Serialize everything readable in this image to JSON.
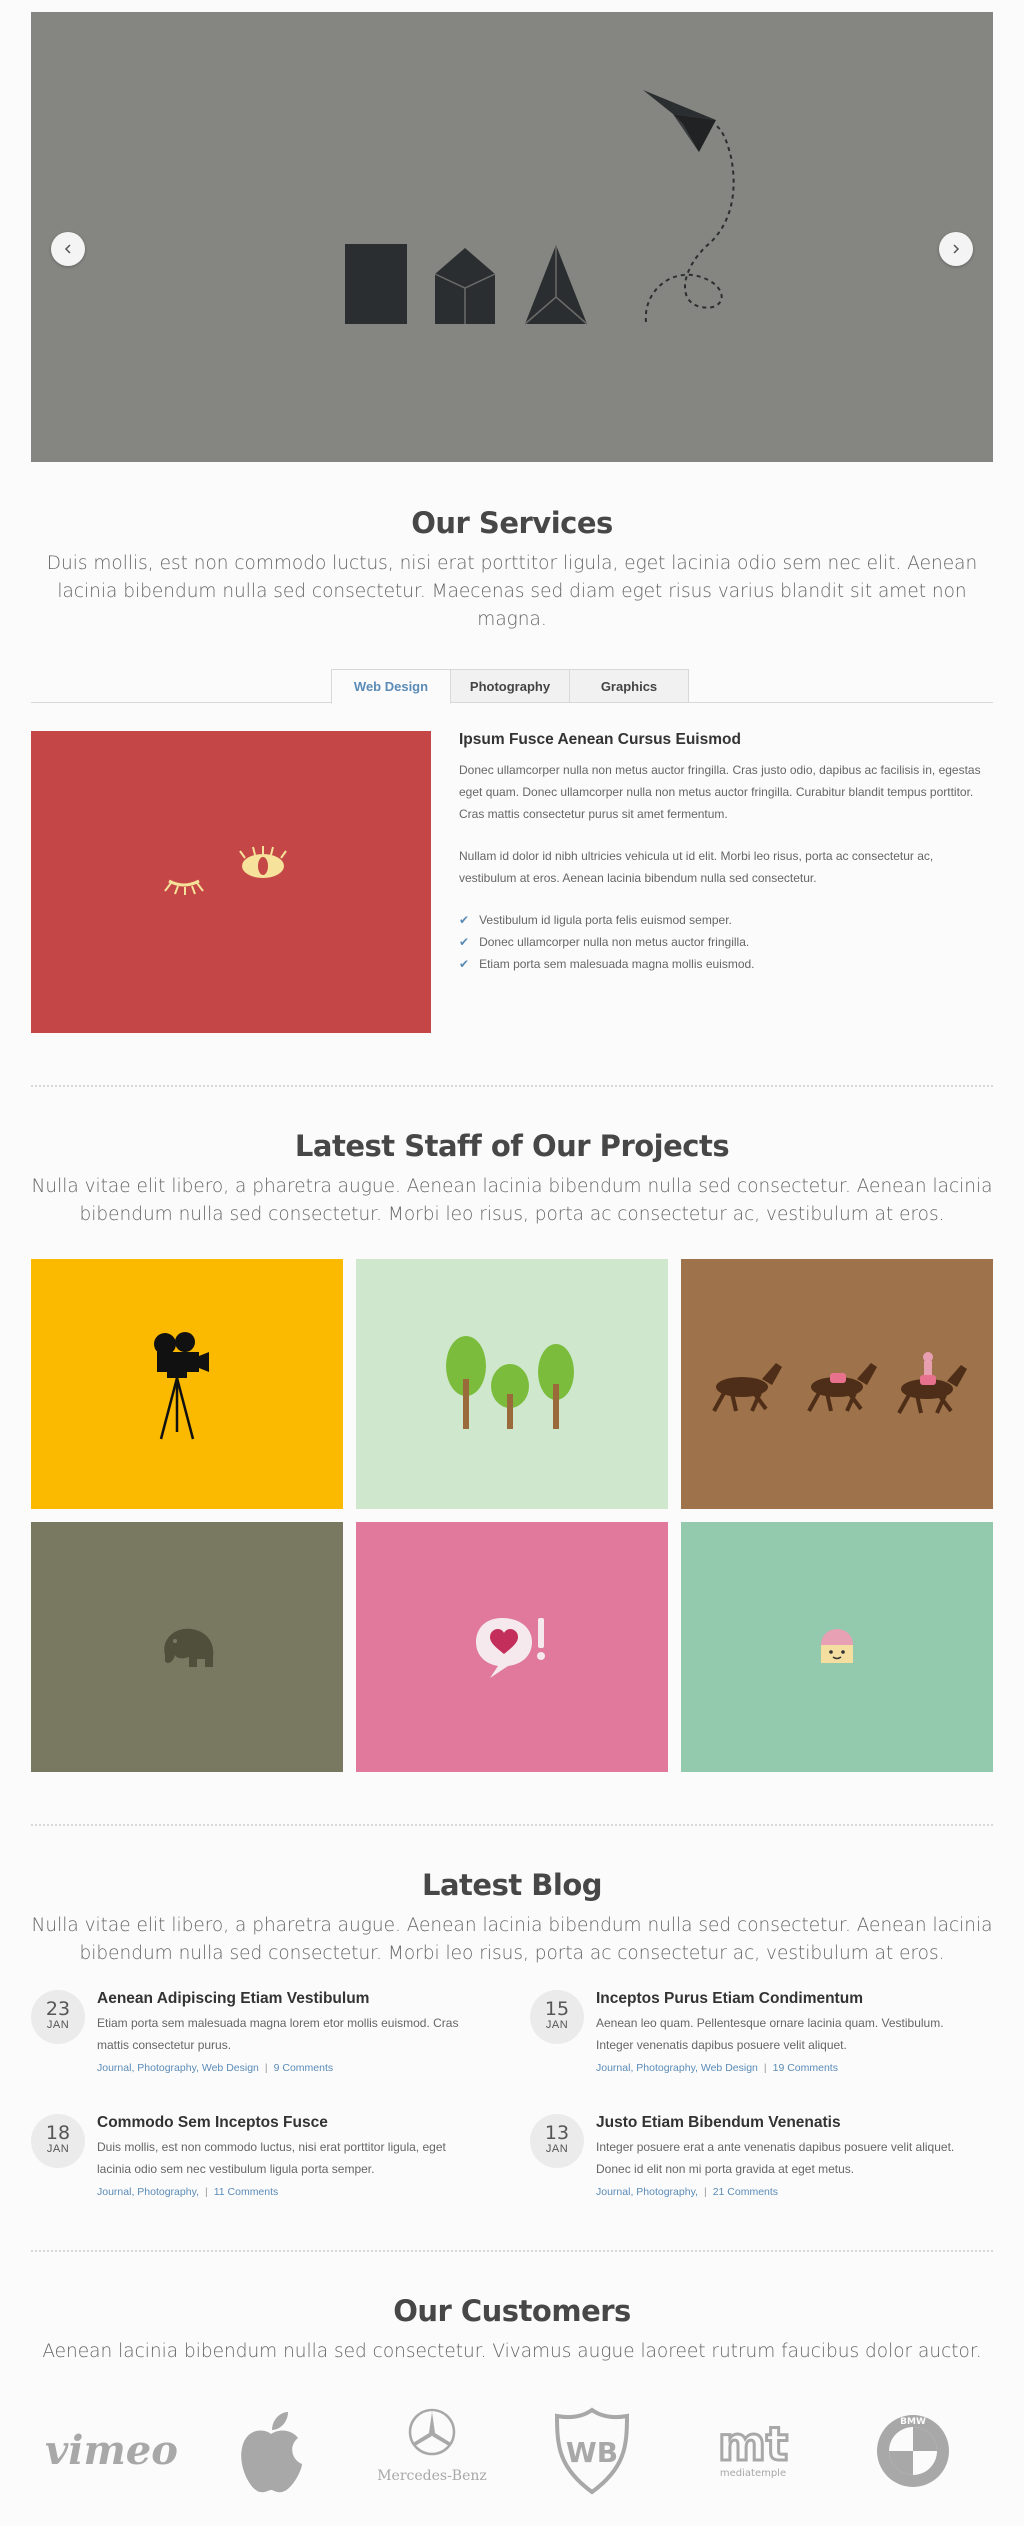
{
  "slider": {
    "prev_icon": "chevron-left-icon",
    "next_icon": "chevron-right-icon",
    "background": "#858681"
  },
  "services": {
    "title": "Our Services",
    "subtitle": "Duis mollis, est non commodo luctus, nisi erat porttitor ligula, eget lacinia odio sem nec elit. Aenean lacinia bibendum nulla sed consectetur. Maecenas sed diam eget risus varius blandit sit amet non magna.",
    "tabs": [
      {
        "label": "Web Design",
        "active": true
      },
      {
        "label": "Photography",
        "active": false
      },
      {
        "label": "Graphics",
        "active": false
      }
    ],
    "content": {
      "heading": "Ipsum Fusce Aenean Cursus Euismod",
      "paragraph1": "Donec ullamcorper nulla non metus auctor fringilla. Cras justo odio, dapibus ac facilisis in, egestas eget quam. Donec ullamcorper nulla non metus auctor fringilla. Curabitur blandit tempus porttitor. Cras mattis consectetur purus sit amet fermentum.",
      "paragraph2": "Nullam id dolor id nibh ultricies vehicula ut id elit. Morbi leo risus, porta ac consectetur ac, vestibulum at eros. Aenean lacinia bibendum nulla sed consectetur.",
      "checklist": [
        "Vestibulum id ligula porta felis euismod semper.",
        "Donec ullamcorper nulla non metus auctor fringilla.",
        "Etiam porta sem malesuada magna mollis euismod."
      ],
      "image_color": "#c44646",
      "check_icon": "check-icon"
    }
  },
  "projects": {
    "title": "Latest Staff of Our Projects",
    "subtitle": "Nulla vitae elit libero, a pharetra augue. Aenean lacinia bibendum nulla sed consectetur. Aenean lacinia bibendum nulla sed consectetur. Morbi leo risus, porta ac consectetur ac, vestibulum at eros.",
    "tiles": [
      {
        "icon": "movie-camera-icon",
        "color": "#fbb900"
      },
      {
        "icon": "trees-icon",
        "color": "#cfe8cd"
      },
      {
        "icon": "horses-icon",
        "color": "#9e724a"
      },
      {
        "icon": "elephant-icon",
        "color": "#797961"
      },
      {
        "icon": "heart-speech-bubble-icon",
        "color": "#e0799c"
      },
      {
        "icon": "cupcake-icon",
        "color": "#93c9ad"
      }
    ]
  },
  "blog": {
    "title": "Latest Blog",
    "subtitle": "Nulla vitae elit libero, a pharetra augue. Aenean lacinia bibendum nulla sed consectetur. Aenean lacinia bibendum nulla sed consectetur. Morbi leo risus, porta ac consectetur ac, vestibulum at eros.",
    "posts": [
      {
        "day": "23",
        "month": "JAN",
        "title": "Aenean Adipiscing Etiam Vestibulum",
        "excerpt": "Etiam porta sem malesuada magna lorem etor mollis euismod. Cras mattis consectetur purus.",
        "categories": "Journal, Photography, Web Design",
        "comments": "9 Comments"
      },
      {
        "day": "15",
        "month": "JAN",
        "title": "Inceptos Purus Etiam Condimentum",
        "excerpt": "Aenean leo quam. Pellentesque ornare lacinia quam. Vestibulum. Integer venenatis dapibus posuere velit aliquet.",
        "categories": "Journal, Photography, Web Design",
        "comments": "19 Comments"
      },
      {
        "day": "18",
        "month": "JAN",
        "title": "Commodo Sem Inceptos Fusce",
        "excerpt": "Duis mollis, est non commodo luctus, nisi erat porttitor ligula, eget lacinia odio sem nec vestibulum ligula porta semper.",
        "categories": "Journal, Photography,",
        "comments": "11 Comments"
      },
      {
        "day": "13",
        "month": "JAN",
        "title": "Justo Etiam Bibendum Venenatis",
        "excerpt": "Integer posuere erat a ante venenatis dapibus posuere velit aliquet. Donec id elit non mi porta gravida at eget metus.",
        "categories": "Journal, Photography,",
        "comments": "21 Comments"
      }
    ],
    "meta_separator": "|"
  },
  "customers": {
    "title": "Our Customers",
    "subtitle": "Aenean lacinia bibendum nulla sed consectetur. Vivamus augue laoreet rutrum faucibus dolor auctor.",
    "logos": [
      {
        "name": "vimeo",
        "icon": "vimeo-logo"
      },
      {
        "name": "apple",
        "icon": "apple-logo"
      },
      {
        "name": "Mercedes-Benz",
        "icon": "mercedes-benz-logo"
      },
      {
        "name": "WB",
        "icon": "warner-bros-logo"
      },
      {
        "name": "mt",
        "icon": "mediatemple-logo",
        "sub": "mediatemple"
      },
      {
        "name": "BMW",
        "icon": "bmw-logo"
      }
    ]
  }
}
